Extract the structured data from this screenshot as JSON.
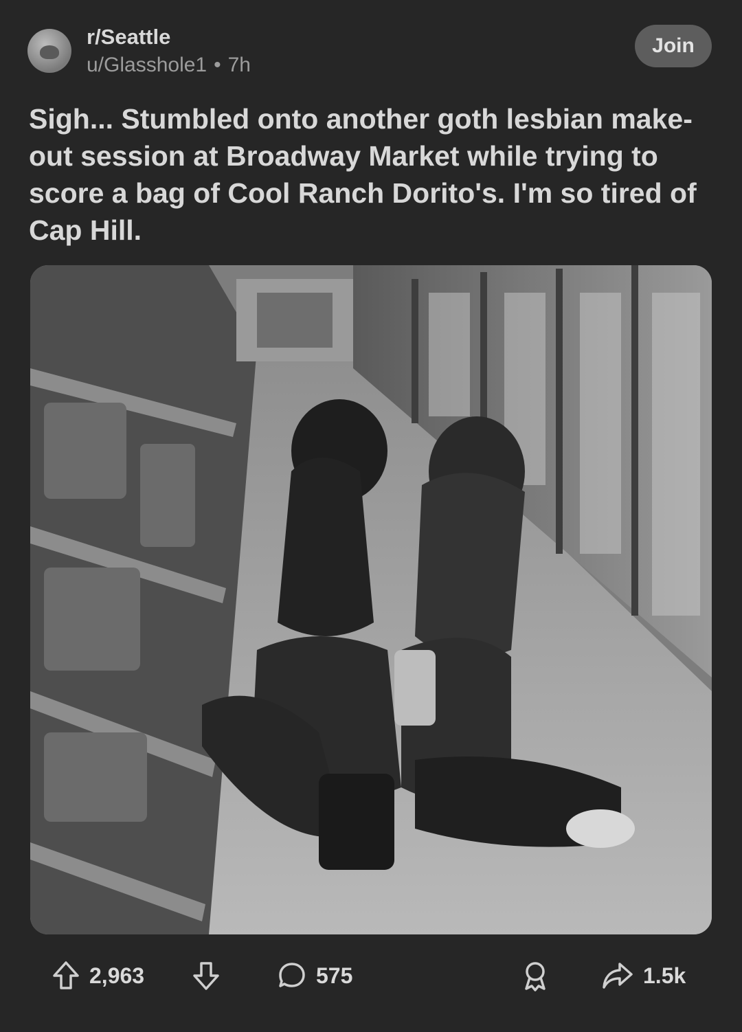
{
  "post": {
    "subreddit": "r/Seattle",
    "author": "u/Glasshole1",
    "separator": "•",
    "age": "7h",
    "join_label": "Join",
    "title": "Sigh... Stumbled onto another goth lesbian make-out session at Broadway Market while trying to score a bag of Cool Ranch Dorito's. I'm so tired of Cap Hill."
  },
  "actions": {
    "upvotes": "2,963",
    "comments": "575",
    "shares": "1.5k"
  },
  "colors": {
    "background": "#262626",
    "join_button": "#5d5d5d",
    "text": "#d8d8d8",
    "muted": "#9c9c9c"
  }
}
